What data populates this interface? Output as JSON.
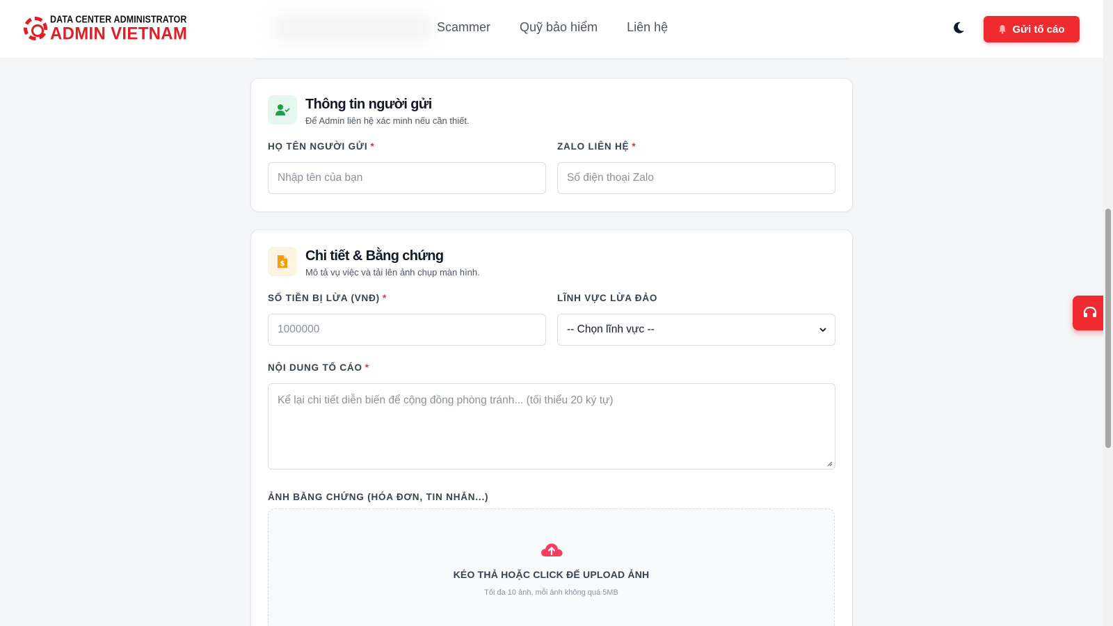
{
  "header": {
    "logo_top": "DATA CENTER ADMINISTRATOR",
    "logo_main": "ADMIN VIETNAM",
    "nav": [
      "Scammer",
      "Quỹ bảo hiểm",
      "Liên hệ"
    ],
    "report_button": "Gửi tố cáo"
  },
  "sender": {
    "title": "Thông tin người gửi",
    "subtitle": "Để Admin liên hệ xác minh nếu cần thiết.",
    "name_label": "HỌ TÊN NGƯỜI GỬI",
    "name_placeholder": "Nhập tên của bạn",
    "zalo_label": "ZALO LIÊN HỆ",
    "zalo_placeholder": "Số điện thoại Zalo",
    "required_mark": "*"
  },
  "details": {
    "title": "Chi tiết & Bằng chứng",
    "subtitle": "Mô tả vụ việc và tải lên ảnh chụp màn hình.",
    "amount_label": "SỐ TIỀN BỊ LỪA (VNĐ)",
    "amount_placeholder": "1000000",
    "field_label": "LĨNH VỰC LỪA ĐẢO",
    "field_selected": "-- Chọn lĩnh vực --",
    "content_label": "NỘI DUNG TỐ CÁO",
    "content_placeholder": "Kể lại chi tiết diễn biến để cộng đồng phòng tránh... (tối thiểu 20 ký tự)",
    "evidence_label": "ẢNH BẰNG CHỨNG (HÓA ĐƠN, TIN NHẮN...)",
    "upload_title": "KÉO THẢ HOẶC CLICK ĐỂ UPLOAD ẢNH",
    "upload_sub": "Tối đa 10 ảnh, mỗi ảnh không quá 5MB",
    "required_mark": "*"
  },
  "colors": {
    "brand_red": "#ef2b2f",
    "green_icon": "#16a34a",
    "orange_icon": "#f59e0b"
  },
  "icons": [
    "logo-gear-icon",
    "moon-icon",
    "bell-icon",
    "user-check-icon",
    "file-dollar-icon",
    "chevron-down-icon",
    "cloud-upload-icon",
    "headset-icon"
  ]
}
